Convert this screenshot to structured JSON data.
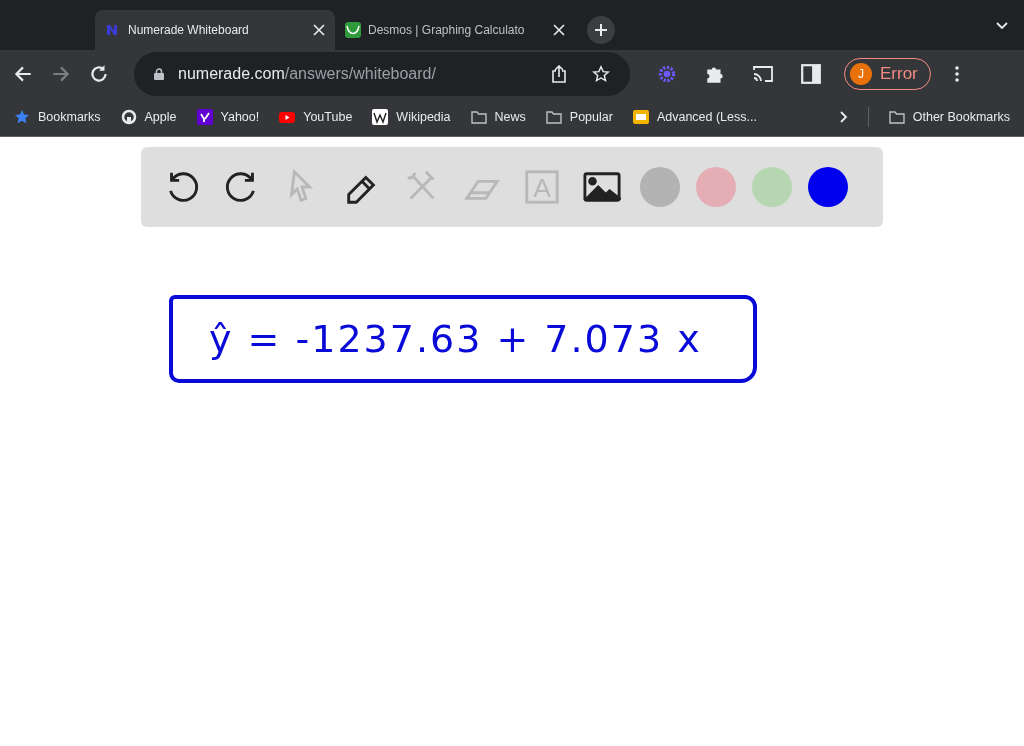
{
  "tabs": [
    {
      "title": "Numerade Whiteboard",
      "selected": true,
      "kind": "numerade"
    },
    {
      "title": "Desmos | Graphing Calculato",
      "selected": false,
      "kind": "desmos"
    }
  ],
  "address": {
    "domain": "numerade.com",
    "path": "/answers/whiteboard/"
  },
  "profile": {
    "initial": "J",
    "label": "Error"
  },
  "bookmarks": [
    {
      "label": "Bookmarks",
      "kind": "star"
    },
    {
      "label": "Apple",
      "kind": "apple"
    },
    {
      "label": "Yahoo!",
      "kind": "yahoo"
    },
    {
      "label": "YouTube",
      "kind": "youtube"
    },
    {
      "label": "Wikipedia",
      "kind": "wiki"
    },
    {
      "label": "News",
      "kind": "folder"
    },
    {
      "label": "Popular",
      "kind": "folder"
    },
    {
      "label": "Advanced (Less...",
      "kind": "slides"
    }
  ],
  "other_bookmarks": "Other Bookmarks",
  "tools": [
    {
      "kind": "undo",
      "disabled": false
    },
    {
      "kind": "redo",
      "disabled": false
    },
    {
      "kind": "pointer",
      "disabled": true
    },
    {
      "kind": "pen",
      "disabled": false
    },
    {
      "kind": "tools",
      "disabled": true
    },
    {
      "kind": "eraser",
      "disabled": true
    },
    {
      "kind": "text",
      "disabled": true,
      "glyph": "A"
    },
    {
      "kind": "image",
      "disabled": false
    }
  ],
  "colors": [
    {
      "color": "#b3b3b3"
    },
    {
      "color": "#e5aeb4"
    },
    {
      "color": "#b6d6b2"
    },
    {
      "color": "#0000ee"
    }
  ],
  "equation": "ŷ = -1237.63 + 7.073 x"
}
